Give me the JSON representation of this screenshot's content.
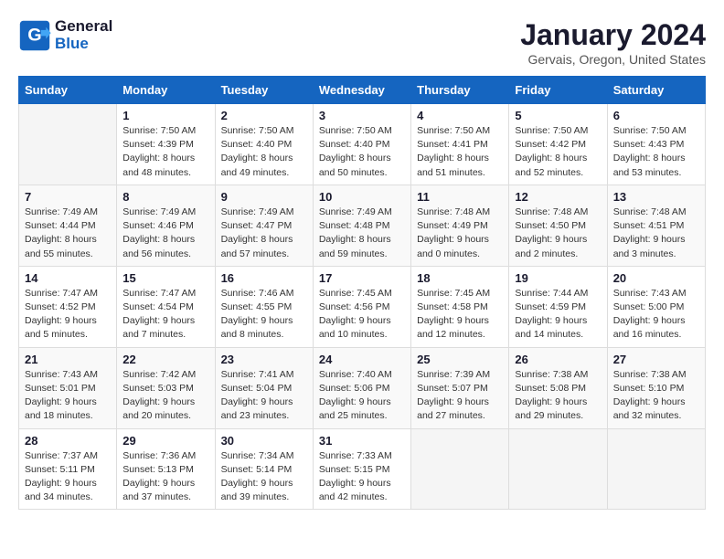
{
  "logo": {
    "line1": "General",
    "line2": "Blue"
  },
  "title": "January 2024",
  "subtitle": "Gervais, Oregon, United States",
  "days_of_week": [
    "Sunday",
    "Monday",
    "Tuesday",
    "Wednesday",
    "Thursday",
    "Friday",
    "Saturday"
  ],
  "weeks": [
    [
      {
        "day": "",
        "info": ""
      },
      {
        "day": "1",
        "info": "Sunrise: 7:50 AM\nSunset: 4:39 PM\nDaylight: 8 hours\nand 48 minutes."
      },
      {
        "day": "2",
        "info": "Sunrise: 7:50 AM\nSunset: 4:40 PM\nDaylight: 8 hours\nand 49 minutes."
      },
      {
        "day": "3",
        "info": "Sunrise: 7:50 AM\nSunset: 4:40 PM\nDaylight: 8 hours\nand 50 minutes."
      },
      {
        "day": "4",
        "info": "Sunrise: 7:50 AM\nSunset: 4:41 PM\nDaylight: 8 hours\nand 51 minutes."
      },
      {
        "day": "5",
        "info": "Sunrise: 7:50 AM\nSunset: 4:42 PM\nDaylight: 8 hours\nand 52 minutes."
      },
      {
        "day": "6",
        "info": "Sunrise: 7:50 AM\nSunset: 4:43 PM\nDaylight: 8 hours\nand 53 minutes."
      }
    ],
    [
      {
        "day": "7",
        "info": "Sunrise: 7:49 AM\nSunset: 4:44 PM\nDaylight: 8 hours\nand 55 minutes."
      },
      {
        "day": "8",
        "info": "Sunrise: 7:49 AM\nSunset: 4:46 PM\nDaylight: 8 hours\nand 56 minutes."
      },
      {
        "day": "9",
        "info": "Sunrise: 7:49 AM\nSunset: 4:47 PM\nDaylight: 8 hours\nand 57 minutes."
      },
      {
        "day": "10",
        "info": "Sunrise: 7:49 AM\nSunset: 4:48 PM\nDaylight: 8 hours\nand 59 minutes."
      },
      {
        "day": "11",
        "info": "Sunrise: 7:48 AM\nSunset: 4:49 PM\nDaylight: 9 hours\nand 0 minutes."
      },
      {
        "day": "12",
        "info": "Sunrise: 7:48 AM\nSunset: 4:50 PM\nDaylight: 9 hours\nand 2 minutes."
      },
      {
        "day": "13",
        "info": "Sunrise: 7:48 AM\nSunset: 4:51 PM\nDaylight: 9 hours\nand 3 minutes."
      }
    ],
    [
      {
        "day": "14",
        "info": "Sunrise: 7:47 AM\nSunset: 4:52 PM\nDaylight: 9 hours\nand 5 minutes."
      },
      {
        "day": "15",
        "info": "Sunrise: 7:47 AM\nSunset: 4:54 PM\nDaylight: 9 hours\nand 7 minutes."
      },
      {
        "day": "16",
        "info": "Sunrise: 7:46 AM\nSunset: 4:55 PM\nDaylight: 9 hours\nand 8 minutes."
      },
      {
        "day": "17",
        "info": "Sunrise: 7:45 AM\nSunset: 4:56 PM\nDaylight: 9 hours\nand 10 minutes."
      },
      {
        "day": "18",
        "info": "Sunrise: 7:45 AM\nSunset: 4:58 PM\nDaylight: 9 hours\nand 12 minutes."
      },
      {
        "day": "19",
        "info": "Sunrise: 7:44 AM\nSunset: 4:59 PM\nDaylight: 9 hours\nand 14 minutes."
      },
      {
        "day": "20",
        "info": "Sunrise: 7:43 AM\nSunset: 5:00 PM\nDaylight: 9 hours\nand 16 minutes."
      }
    ],
    [
      {
        "day": "21",
        "info": "Sunrise: 7:43 AM\nSunset: 5:01 PM\nDaylight: 9 hours\nand 18 minutes."
      },
      {
        "day": "22",
        "info": "Sunrise: 7:42 AM\nSunset: 5:03 PM\nDaylight: 9 hours\nand 20 minutes."
      },
      {
        "day": "23",
        "info": "Sunrise: 7:41 AM\nSunset: 5:04 PM\nDaylight: 9 hours\nand 23 minutes."
      },
      {
        "day": "24",
        "info": "Sunrise: 7:40 AM\nSunset: 5:06 PM\nDaylight: 9 hours\nand 25 minutes."
      },
      {
        "day": "25",
        "info": "Sunrise: 7:39 AM\nSunset: 5:07 PM\nDaylight: 9 hours\nand 27 minutes."
      },
      {
        "day": "26",
        "info": "Sunrise: 7:38 AM\nSunset: 5:08 PM\nDaylight: 9 hours\nand 29 minutes."
      },
      {
        "day": "27",
        "info": "Sunrise: 7:38 AM\nSunset: 5:10 PM\nDaylight: 9 hours\nand 32 minutes."
      }
    ],
    [
      {
        "day": "28",
        "info": "Sunrise: 7:37 AM\nSunset: 5:11 PM\nDaylight: 9 hours\nand 34 minutes."
      },
      {
        "day": "29",
        "info": "Sunrise: 7:36 AM\nSunset: 5:13 PM\nDaylight: 9 hours\nand 37 minutes."
      },
      {
        "day": "30",
        "info": "Sunrise: 7:34 AM\nSunset: 5:14 PM\nDaylight: 9 hours\nand 39 minutes."
      },
      {
        "day": "31",
        "info": "Sunrise: 7:33 AM\nSunset: 5:15 PM\nDaylight: 9 hours\nand 42 minutes."
      },
      {
        "day": "",
        "info": ""
      },
      {
        "day": "",
        "info": ""
      },
      {
        "day": "",
        "info": ""
      }
    ]
  ]
}
